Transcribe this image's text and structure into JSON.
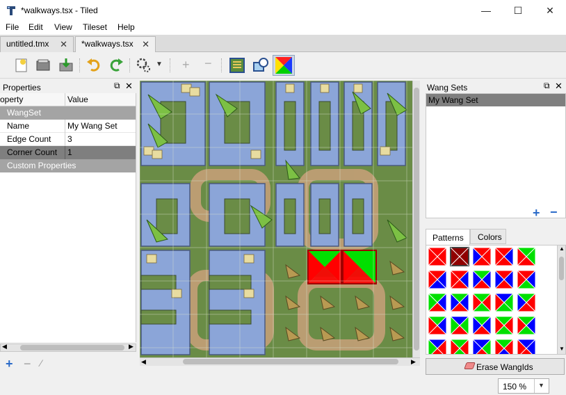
{
  "window": {
    "title": "*walkways.tsx - Tiled",
    "controls": {
      "minimize": "—",
      "maximize": "☐",
      "close": "✕"
    }
  },
  "menu": [
    "File",
    "Edit",
    "View",
    "Tileset",
    "Help"
  ],
  "tabs": [
    {
      "label": "untitled.tmx",
      "active": false
    },
    {
      "label": "*walkways.tsx",
      "active": true
    }
  ],
  "properties_panel": {
    "title": "Properties",
    "header": {
      "property": "operty",
      "value": "Value"
    },
    "group": "WangSet",
    "rows": [
      {
        "name": "Name",
        "value": "My Wang Set",
        "selected": false
      },
      {
        "name": "Edge Count",
        "value": "3",
        "selected": false
      },
      {
        "name": "Corner Count",
        "value": "1",
        "selected": true
      }
    ],
    "custom_group": "Custom Properties"
  },
  "wang_panel": {
    "title": "Wang Sets",
    "items": [
      {
        "label": "My Wang Set",
        "selected": true
      }
    ],
    "tabs": [
      {
        "label": "Patterns",
        "active": true
      },
      {
        "label": "Colors",
        "active": false
      }
    ],
    "erase_button": "Erase WangIds"
  },
  "zoom": {
    "value": "150 %"
  },
  "colors": {
    "red": "#ff0000",
    "green": "#00e000",
    "blue": "#0000ff",
    "selection": "#7f7f7f",
    "group_header": "#a4a4a4"
  }
}
